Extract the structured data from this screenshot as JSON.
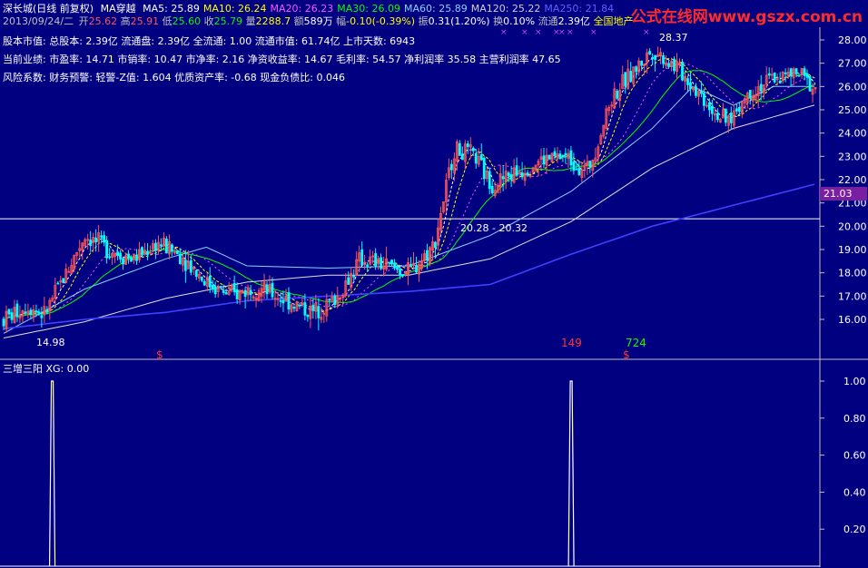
{
  "header": {
    "stock_name": "深长城(日线 前复权)",
    "indicator_name": "MA穿越",
    "ma": [
      {
        "label": "MA5:",
        "value": "25.89",
        "color": "#ffffff"
      },
      {
        "label": "MA10:",
        "value": "26.24",
        "color": "#ffff00"
      },
      {
        "label": "MA20:",
        "value": "26.23",
        "color": "#ff55ff"
      },
      {
        "label": "MA30:",
        "value": "26.09",
        "color": "#00ff00"
      },
      {
        "label": "MA60:",
        "value": "25.89",
        "color": "#8ad0ff"
      },
      {
        "label": "MA120:",
        "value": "25.22",
        "color": "#d0d0d0"
      },
      {
        "label": "MA250:",
        "value": "21.84",
        "color": "#6060ff"
      }
    ],
    "date": "2013/09/24/二",
    "open_label": "开",
    "open": "25.62",
    "high_label": "高",
    "high": "25.91",
    "low_label": "低",
    "low": "25.60",
    "close_label": "收",
    "close": "25.79",
    "volume_label": "量",
    "volume": "2288.7",
    "amount_label": "额",
    "amount": "589万",
    "change_label": "幅",
    "change": "-0.10(-0.39%)",
    "amplitude_label": "振",
    "amplitude": "0.31(1.20%)",
    "turnover_label": "换",
    "turnover": "0.10%",
    "float_label": "流通",
    "float": "2.39亿",
    "sector": "全国地产"
  },
  "info_lines": [
    "股本市值: 总股本: 2.39亿 流通盘: 2.39亿 全流通: 1.00 流通市值: 61.74亿 上市天数: 6943",
    "当前业绩: 市盈率: 14.71 市销率: 10.47 市净率: 2.16 净资收益率: 14.67 毛利率: 54.57 净利润率 35.58 主营利润率 47.65",
    "风险系数: 财务预警: 轻警-Z值: 1.604 优质资产率: -0.68 现金负债比: 0.046"
  ],
  "logo": "公式在线网www.gszx.com.cn",
  "price_tag": "21.03",
  "annotations": {
    "low_label": "14.98",
    "high_label": "28.37",
    "range_label": "20.28 - 20.32",
    "mark1": "149",
    "mark2": "724",
    "dollar": "$"
  },
  "indicator_panel": {
    "title": "三增三阳 XG: 0.00",
    "axis": [
      "1.00",
      "0.80",
      "0.60",
      "0.40",
      "0.20"
    ],
    "signals_at_fraction": [
      0.06,
      0.7
    ]
  },
  "chart_data": {
    "type": "candlestick",
    "y_axis_ticks": [
      "28.00",
      "27.00",
      "26.00",
      "25.00",
      "24.00",
      "23.00",
      "22.00",
      "21.00",
      "20.00",
      "19.00",
      "18.00",
      "17.00",
      "16.00"
    ],
    "ylim": [
      15.0,
      28.5
    ],
    "indicator_ylim": [
      0,
      1.1
    ],
    "colors": {
      "up": "#ff5555",
      "down": "#00ffff",
      "ma5": "#ffffff",
      "ma10": "#ffff00",
      "ma20": "#ff55ff",
      "ma30": "#00ff00",
      "ma60": "#8ad0ff",
      "ma120": "#e0e0e0",
      "ma250": "#4040ff",
      "grid": "#c0c0c0"
    },
    "candle_path_knots": [
      [
        0,
        16.0
      ],
      [
        0.03,
        16.6
      ],
      [
        0.05,
        16.2
      ],
      [
        0.08,
        18.2
      ],
      [
        0.1,
        19.6
      ],
      [
        0.13,
        19.0
      ],
      [
        0.16,
        18.6
      ],
      [
        0.19,
        19.3
      ],
      [
        0.22,
        18.7
      ],
      [
        0.25,
        17.6
      ],
      [
        0.28,
        17.0
      ],
      [
        0.31,
        17.4
      ],
      [
        0.35,
        16.8
      ],
      [
        0.38,
        16.3
      ],
      [
        0.41,
        16.9
      ],
      [
        0.44,
        18.6
      ],
      [
        0.47,
        18.3
      ],
      [
        0.5,
        18.0
      ],
      [
        0.53,
        19.2
      ],
      [
        0.555,
        23.3
      ],
      [
        0.58,
        23.0
      ],
      [
        0.6,
        21.8
      ],
      [
        0.63,
        22.3
      ],
      [
        0.66,
        22.8
      ],
      [
        0.69,
        23.0
      ],
      [
        0.72,
        22.4
      ],
      [
        0.75,
        25.6
      ],
      [
        0.78,
        26.8
      ],
      [
        0.8,
        27.6
      ],
      [
        0.83,
        26.8
      ],
      [
        0.86,
        25.6
      ],
      [
        0.89,
        24.4
      ],
      [
        0.92,
        25.8
      ],
      [
        0.95,
        26.4
      ],
      [
        0.98,
        26.5
      ],
      [
        1.0,
        25.9
      ]
    ],
    "ma120_knots": [
      [
        0,
        15.2
      ],
      [
        0.1,
        15.9
      ],
      [
        0.2,
        16.9
      ],
      [
        0.3,
        17.6
      ],
      [
        0.4,
        17.9
      ],
      [
        0.5,
        17.9
      ],
      [
        0.6,
        18.6
      ],
      [
        0.7,
        20.2
      ],
      [
        0.8,
        22.5
      ],
      [
        0.9,
        24.2
      ],
      [
        1.0,
        25.2
      ]
    ],
    "ma250_knots": [
      [
        0,
        15.6
      ],
      [
        0.1,
        16.0
      ],
      [
        0.2,
        16.3
      ],
      [
        0.3,
        16.8
      ],
      [
        0.4,
        17.0
      ],
      [
        0.5,
        17.2
      ],
      [
        0.6,
        17.5
      ],
      [
        0.7,
        18.8
      ],
      [
        0.8,
        20.0
      ],
      [
        0.9,
        20.9
      ],
      [
        1.0,
        21.8
      ]
    ],
    "ma60_knots": [
      [
        0,
        15.4
      ],
      [
        0.1,
        17.3
      ],
      [
        0.2,
        18.6
      ],
      [
        0.25,
        19.1
      ],
      [
        0.3,
        18.3
      ],
      [
        0.4,
        18.2
      ],
      [
        0.5,
        18.3
      ],
      [
        0.6,
        19.6
      ],
      [
        0.7,
        21.5
      ],
      [
        0.8,
        24.2
      ],
      [
        0.85,
        26.0
      ],
      [
        0.9,
        25.2
      ],
      [
        0.95,
        26.0
      ],
      [
        1.0,
        26.0
      ]
    ]
  }
}
